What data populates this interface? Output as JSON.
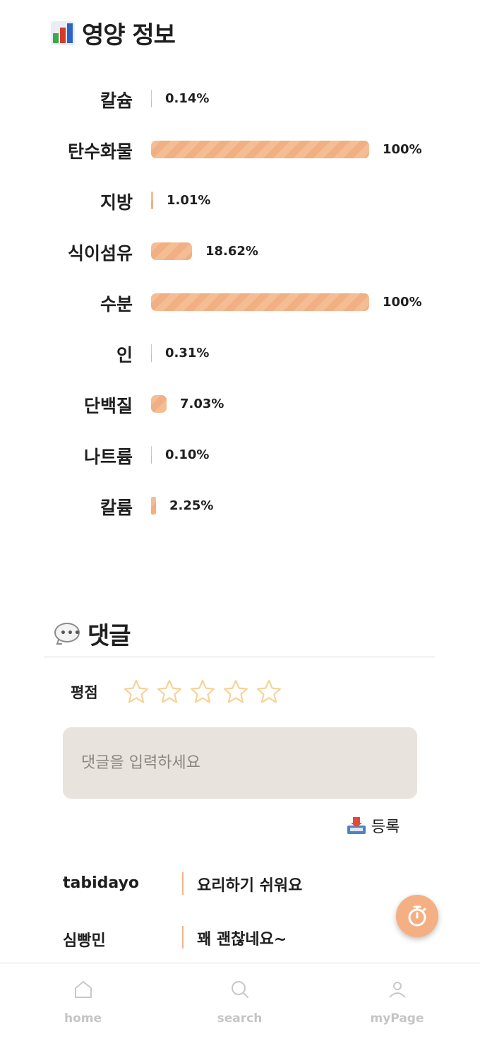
{
  "nutrition": {
    "title": "영양 정보",
    "title_icon": "bar-chart-icon",
    "bar_color": "#f5bd93",
    "items": [
      {
        "label": "칼슘",
        "value": "0.14%",
        "percent": 0.14
      },
      {
        "label": "탄수화물",
        "value": "100%",
        "percent": 100
      },
      {
        "label": "지방",
        "value": "1.01%",
        "percent": 1.01
      },
      {
        "label": "식이섬유",
        "value": "18.62%",
        "percent": 18.62
      },
      {
        "label": "수분",
        "value": "100%",
        "percent": 100
      },
      {
        "label": "인",
        "value": "0.31%",
        "percent": 0.31
      },
      {
        "label": "단백질",
        "value": "7.03%",
        "percent": 7.03
      },
      {
        "label": "나트륨",
        "value": "0.10%",
        "percent": 0.1
      },
      {
        "label": "칼륨",
        "value": "2.25%",
        "percent": 2.25
      }
    ]
  },
  "comments": {
    "title": "댓글",
    "title_icon": "speech-bubble-icon",
    "rating_label": "평점",
    "rating_value": 0,
    "rating_max": 5,
    "star_color": "#f5d39a",
    "input_placeholder": "댓글을 입력하세요",
    "submit_icon": "inbox-tray-icon",
    "submit_label": "등록",
    "list": [
      {
        "author": "tabidayo",
        "text": "요리하기 쉬워요"
      },
      {
        "author": "심빵민",
        "text": "꽤 괜찮네요~"
      }
    ]
  },
  "fab": {
    "icon": "stopwatch-icon",
    "color": "#f4b083"
  },
  "nav": {
    "items": [
      {
        "label": "home",
        "icon": "home-icon"
      },
      {
        "label": "search",
        "icon": "search-icon"
      },
      {
        "label": "myPage",
        "icon": "user-icon"
      }
    ]
  }
}
